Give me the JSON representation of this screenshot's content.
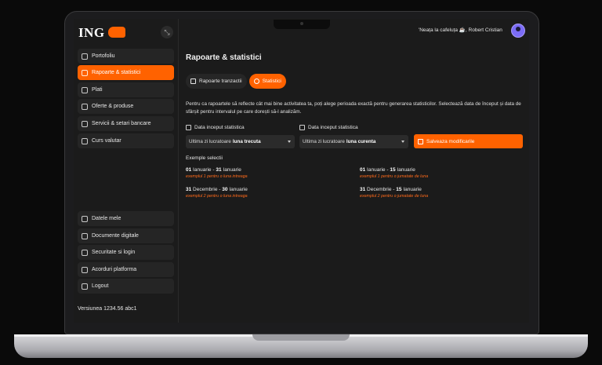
{
  "header": {
    "greeting": "'Neața la cafeluța ☕, Robert Cristian"
  },
  "brand": {
    "logo_text": "ING"
  },
  "sidebar": {
    "items": [
      {
        "label": "Portofoliu"
      },
      {
        "label": "Rapoarte & statistici"
      },
      {
        "label": "Plati"
      },
      {
        "label": "Oferte & produse"
      },
      {
        "label": "Servicii & setari bancare"
      },
      {
        "label": "Curs valutar"
      }
    ],
    "bottom_items": [
      {
        "label": "Datele mele"
      },
      {
        "label": "Documente digitale"
      },
      {
        "label": "Securitate si login"
      },
      {
        "label": "Acorduri platforma"
      },
      {
        "label": "Logout"
      }
    ],
    "version": "Versiunea 1234.56 abc1"
  },
  "main": {
    "title": "Rapoarte & statistici",
    "tabs": [
      {
        "label": "Rapoarte tranzactii"
      },
      {
        "label": "Statistici"
      }
    ],
    "description": "Pentru ca rapoartele să reflecte cât mai bine activitatea ta, poți alege perioada exactă pentru generarea statisticilor. Selectează data de început și data de sfârșit pentru intervalul pe care dorești să-l analizăm.",
    "start_field": {
      "label": "Data inceput statistica",
      "value_prefix": "Ultima zi lucratoare",
      "value_bold": "luna trecuta"
    },
    "end_field": {
      "label": "Data inceput statistica",
      "value_prefix": "Ultima zi lucratoare",
      "value_bold": "luna curenta"
    },
    "save_label": "Salveaza modificarile",
    "examples_title": "Exemple selectii",
    "examples": [
      {
        "d1": "01",
        "m1": "Ianuarie",
        "sep": "-",
        "d2": "31",
        "m2": "Ianuarie",
        "note": "exemplul 1 pentru o luna intreaga"
      },
      {
        "d1": "01",
        "m1": "Ianuarie",
        "sep": "-",
        "d2": "15",
        "m2": "Ianuarie",
        "note": "exemplul 1 pentru o jumatate de luna"
      },
      {
        "d1": "31",
        "m1": "Decembrie",
        "sep": "-",
        "d2": "30",
        "m2": "Ianuarie",
        "note": "exemplul 2 pentru o luna intreaga"
      },
      {
        "d1": "31",
        "m1": "Decembrie",
        "sep": "-",
        "d2": "15",
        "m2": "Ianuarie",
        "note": "exemplul 2 pentru o jumatate de luna"
      }
    ]
  },
  "colors": {
    "accent": "#ff6200",
    "background": "#1b1b1b",
    "surface": "#252525"
  },
  "icons": [
    "home-icon",
    "report-icon",
    "payments-icon",
    "offers-icon",
    "settings-icon",
    "currency-icon",
    "user-card-icon",
    "document-icon",
    "lock-icon",
    "agreement-icon",
    "logout-icon",
    "calendar-icon",
    "save-icon",
    "table-icon",
    "refresh-icon",
    "collapse-icon"
  ]
}
